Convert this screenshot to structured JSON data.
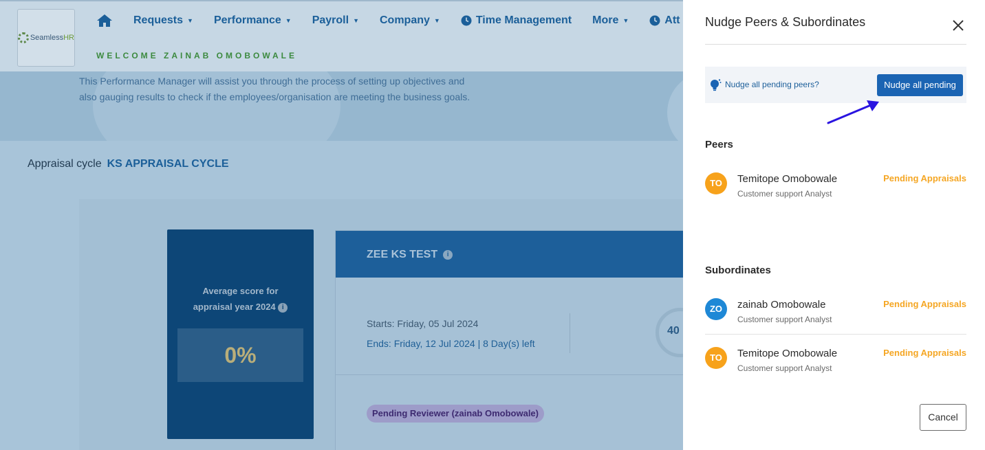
{
  "app": {
    "logo_text": "SeamlessHR",
    "logo_text_left": "Seamless",
    "logo_text_right": "HR",
    "nav": [
      {
        "label": "Requests"
      },
      {
        "label": "Performance"
      },
      {
        "label": "Payroll"
      },
      {
        "label": "Company"
      },
      {
        "label": "Time Management"
      },
      {
        "label": "More"
      },
      {
        "label": "Att"
      }
    ],
    "welcome": "WELCOME ZAINAB OMOBOWALE"
  },
  "hero": {
    "description_line1": "This Performance Manager will assist you through the process of setting up objectives and",
    "description_line2": "also gauging results to check if the employees/organisation are meeting the business goals."
  },
  "appraisal": {
    "cycle_label": "Appraisal cycle",
    "cycle_value": "KS APPRAISAL CYCLE",
    "score_label_line1": "Average score for",
    "score_label_line2": "appraisal year 2024",
    "score_value": "0%",
    "card_title": "ZEE KS TEST",
    "starts": "Starts: Friday, 05 Jul 2024",
    "ends": "Ends: Friday, 12 Jul 2024 | 8 Day(s) left",
    "ring_value": "40",
    "pending_reviewer": "Pending Reviewer (zainab Omobowale)"
  },
  "drawer": {
    "title": "Nudge Peers & Subordinates",
    "nudge_question": "Nudge all pending peers?",
    "nudge_button": "Nudge all pending",
    "peers_heading": "Peers",
    "peers": [
      {
        "initials": "TO",
        "name": "Temitope Omobowale",
        "role": "Customer support Analyst",
        "status": "Pending Appraisals",
        "color": "#f7a21b"
      }
    ],
    "subordinates_heading": "Subordinates",
    "subordinates": [
      {
        "initials": "ZO",
        "name": "zainab Omobowale",
        "role": "Customer support Analyst",
        "status": "Pending Appraisals",
        "color": "#1e88d6"
      },
      {
        "initials": "TO",
        "name": "Temitope Omobowale",
        "role": "Customer support Analyst",
        "status": "Pending Appraisals",
        "color": "#f7a21b"
      }
    ],
    "cancel_label": "Cancel"
  },
  "colors": {
    "primary": "#1b64b3",
    "pending_orange": "#f5a623",
    "annotation_arrow": "#2a14e0"
  }
}
